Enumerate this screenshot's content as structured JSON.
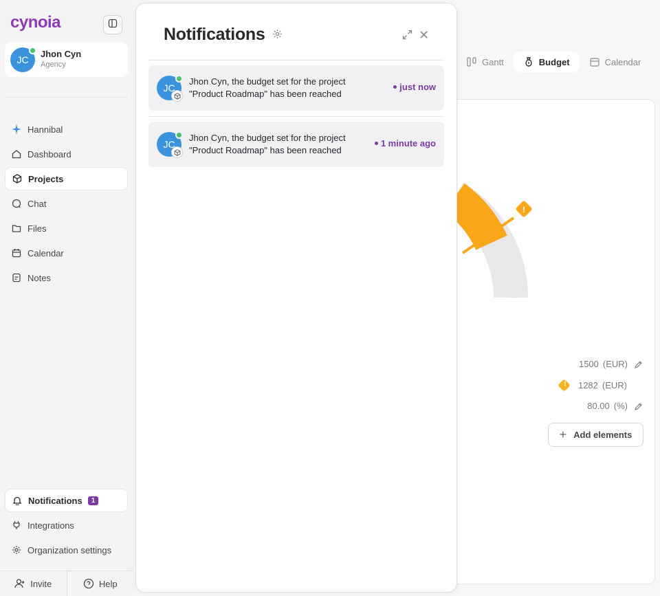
{
  "app": {
    "logo": "cynoia"
  },
  "user": {
    "initials": "JC",
    "name": "Jhon Cyn",
    "role": "Agency"
  },
  "sidebar": {
    "items": [
      {
        "label": "Hannibal",
        "icon": "sparkle-icon"
      },
      {
        "label": "Dashboard",
        "icon": "home-icon"
      },
      {
        "label": "Projects",
        "icon": "cube-icon"
      },
      {
        "label": "Chat",
        "icon": "chat-icon"
      },
      {
        "label": "Files",
        "icon": "folder-icon"
      },
      {
        "label": "Calendar",
        "icon": "calendar-icon"
      },
      {
        "label": "Notes",
        "icon": "notes-icon"
      }
    ],
    "bottom_items": [
      {
        "label": "Notifications",
        "icon": "bell-icon",
        "badge": "1"
      },
      {
        "label": "Integrations",
        "icon": "plug-icon"
      },
      {
        "label": "Organization settings",
        "icon": "gear-icon"
      }
    ],
    "footer": {
      "invite": "Invite",
      "help": "Help"
    }
  },
  "view_tabs": [
    {
      "label": "Gantt",
      "icon": "gantt-icon"
    },
    {
      "label": "Budget",
      "icon": "money-bag-icon"
    },
    {
      "label": "Calendar",
      "icon": "calendar-icon"
    }
  ],
  "budget": {
    "gauge_fraction_used": 0.85,
    "rows": [
      {
        "value": "1500",
        "unit": "(EUR)"
      },
      {
        "value": "1282",
        "unit": "(EUR)"
      },
      {
        "value": "80.00",
        "unit": "(%)"
      }
    ],
    "add_elements": "Add elements",
    "colors": {
      "gauge_fill": "#f9a61a",
      "gauge_track": "#e8e8ea",
      "warning": "#f4b31d"
    }
  },
  "notifications": {
    "title": "Notifications",
    "items": [
      {
        "initials": "JC",
        "text": "Jhon Cyn, the budget set for the project \"Product Roadmap\" has been reached",
        "time": "just now"
      },
      {
        "initials": "JC",
        "text": "Jhon Cyn, the budget set for the project \"Product Roadmap\" has been reached",
        "time": "1 minute ago"
      }
    ]
  }
}
